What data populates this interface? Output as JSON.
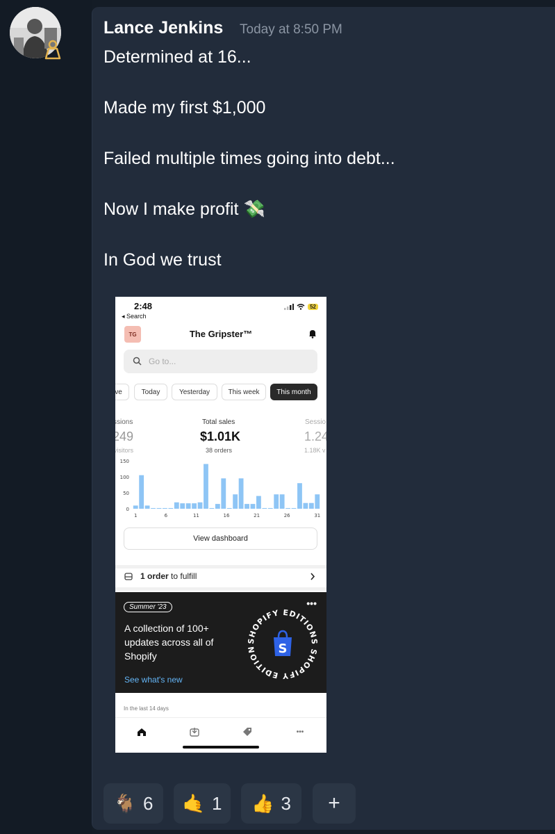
{
  "message": {
    "author": "Lance Jenkins",
    "timestamp": "Today at 8:50 PM",
    "lines": [
      "Determined at 16...",
      "Made my first $1,000",
      "Failed multiple times going into debt...",
      "Now I make profit 💸",
      "In God we trust"
    ]
  },
  "screenshot": {
    "status_time": "2:48",
    "back_label": "◂ Search",
    "battery": "52",
    "store_initials": "TG",
    "store_name": "The Gripster™",
    "search_placeholder": "Go to...",
    "filters": [
      "ve",
      "Today",
      "Yesterday",
      "This week",
      "This month"
    ],
    "active_filter": "This month",
    "metrics": {
      "left": {
        "label": "ssions",
        "value": "249",
        "sub": "visitors"
      },
      "center": {
        "label": "Total sales",
        "value": "$1.01K",
        "sub": "38 orders"
      },
      "right": {
        "label": "Sessio",
        "value": "1.24",
        "sub": "1.18K v"
      }
    },
    "view_dashboard": "View dashboard",
    "fulfill_count": "1 order",
    "fulfill_rest": " to fulfill",
    "promo": {
      "tag": "Summer '23",
      "text": "A collection of 100+ updates across all of Shopify",
      "link": "See what's new",
      "badge_text": "SHOPIFY EDITIONS SHOPIFY EDITIONS"
    },
    "recent_label": "In the last 14 days"
  },
  "chart_data": {
    "type": "bar",
    "categories": [
      1,
      2,
      3,
      4,
      5,
      6,
      7,
      8,
      9,
      10,
      11,
      12,
      13,
      14,
      15,
      16,
      17,
      18,
      19,
      20,
      21,
      22,
      23,
      24,
      25,
      26,
      27,
      28,
      29,
      30,
      31
    ],
    "x_tick_labels": [
      "1",
      "6",
      "11",
      "16",
      "21",
      "26",
      "31"
    ],
    "values": [
      10,
      105,
      10,
      2,
      2,
      2,
      2,
      20,
      17,
      17,
      17,
      20,
      140,
      2,
      15,
      95,
      2,
      45,
      95,
      15,
      15,
      40,
      2,
      2,
      45,
      45,
      2,
      2,
      80,
      18,
      18,
      45
    ],
    "y_ticks": [
      "150",
      "100",
      "50",
      "0"
    ],
    "ylim": [
      0,
      150
    ],
    "color": "#8ec5f5"
  },
  "reactions": [
    {
      "emoji": "🐐",
      "count": "6"
    },
    {
      "emoji": "🤙",
      "count": "1"
    },
    {
      "emoji": "👍",
      "count": "3"
    },
    {
      "emoji": "+",
      "count": ""
    }
  ]
}
